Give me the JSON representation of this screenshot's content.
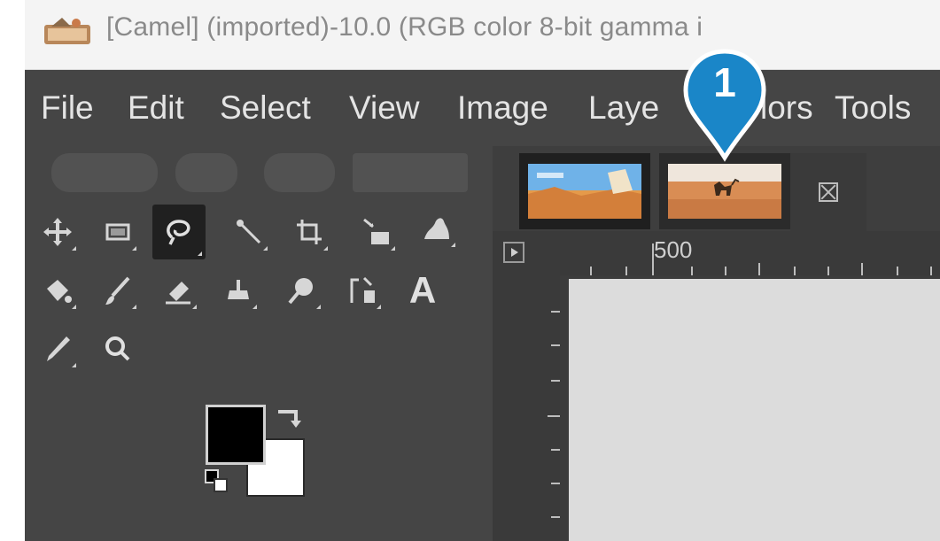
{
  "title_bar": {
    "title": "[Camel] (imported)-10.0 (RGB color 8-bit gamma i",
    "icon": "gimp-app-icon"
  },
  "menubar": {
    "items": [
      "File",
      "Edit",
      "Select",
      "View",
      "Image",
      "Laye",
      "lors",
      "Tools"
    ]
  },
  "toolbox": {
    "tools": [
      {
        "icon": "move-icon"
      },
      {
        "icon": "rect-select-icon"
      },
      {
        "icon": "free-select-icon",
        "active": true
      },
      {
        "icon": "measure-icon"
      },
      {
        "icon": "crop-icon"
      },
      {
        "icon": "unified-transform-icon"
      },
      {
        "icon": "warp-transform-icon"
      },
      {
        "icon": "bucket-fill-icon"
      },
      {
        "icon": "paintbrush-icon"
      },
      {
        "icon": "eraser-icon"
      },
      {
        "icon": "clone-icon"
      },
      {
        "icon": "smudge-icon"
      },
      {
        "icon": "paths-icon"
      },
      {
        "icon": "text-tool-icon",
        "glyph": "A"
      },
      {
        "icon": "color-picker-icon"
      },
      {
        "icon": "zoom-icon"
      }
    ],
    "fg_color": "#000000",
    "bg_color": "#ffffff"
  },
  "image_tabs": [
    {
      "name": "desert-thumbnail-1",
      "active": false
    },
    {
      "name": "camel-thumbnail",
      "active": true
    }
  ],
  "ruler": {
    "label": "500"
  },
  "callout": {
    "number": "1",
    "color": "#1a86c8"
  },
  "colors": {
    "window_bg": "#454545",
    "menu_text": "#e4e4e4",
    "accent": "#1a86c8"
  }
}
